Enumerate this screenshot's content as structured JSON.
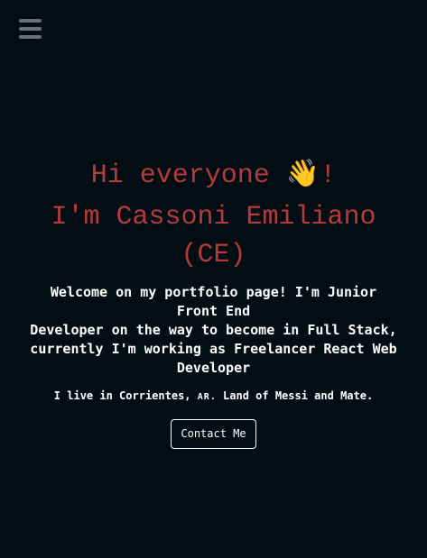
{
  "menu": {
    "icon": "hamburger-menu-icon",
    "color": "#6d6f72"
  },
  "hero": {
    "greeting_prefix": "Hi everyone ",
    "greeting_emoji": "👋",
    "greeting_suffix": "!",
    "name": "I'm Cassoni Emiliano (CE)",
    "intro_line1": "Welcome on my portfolio page! I'm Junior Front End",
    "intro_line2": "Developer on the way to become in Full Stack, currently I'm working as Freelancer React Web Developer",
    "location_prefix": "I live in Corrientes, ",
    "location_country": "AR.",
    "location_suffix": " Land of Messi and Mate.",
    "contact_label": "Contact Me"
  },
  "colors": {
    "background": "#020d14",
    "accent": "#b53b3b",
    "text": "#ffffff"
  }
}
